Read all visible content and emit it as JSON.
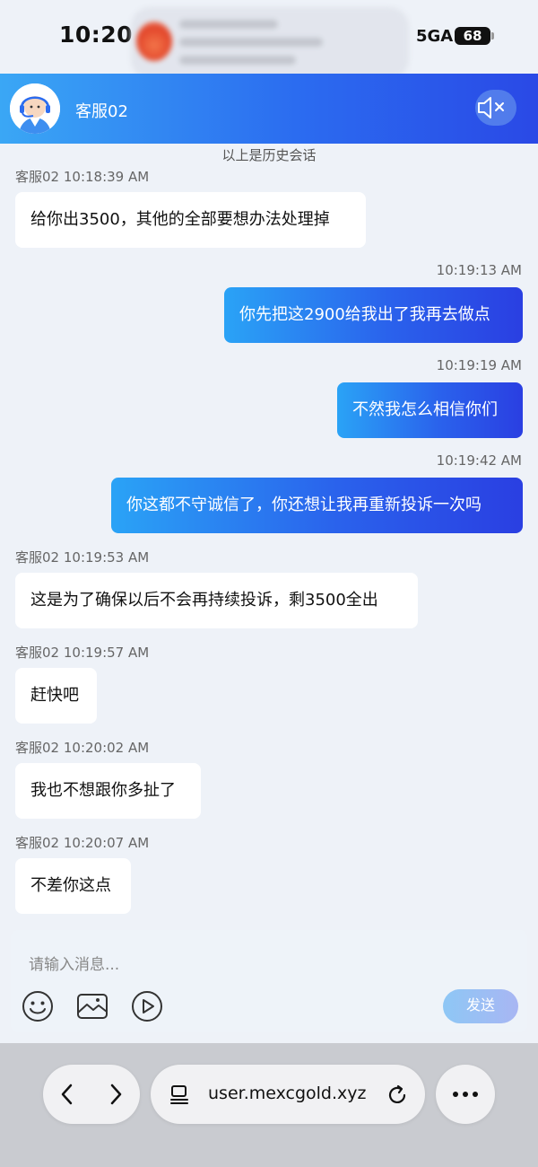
{
  "status": {
    "time": "10:20",
    "network": "5GA",
    "battery": "68"
  },
  "header": {
    "agent_name": "客服02"
  },
  "history_note": "以上是历史会话",
  "messages": [
    {
      "side": "left",
      "meta": "客服02 10:18:39 AM",
      "text": "给你出3500，其他的全部要想办法处理掉"
    },
    {
      "side": "right",
      "meta": "10:19:13 AM",
      "text": "你先把这2900给我出了我再去做点"
    },
    {
      "side": "right",
      "meta": "10:19:19 AM",
      "text": "不然我怎么相信你们"
    },
    {
      "side": "right",
      "meta": "10:19:42 AM",
      "text": "你这都不守诚信了，你还想让我再重新投诉一次吗"
    },
    {
      "side": "left",
      "meta": "客服02 10:19:53 AM",
      "text": "这是为了确保以后不会再持续投诉，剩3500全出"
    },
    {
      "side": "left",
      "meta": "客服02 10:19:57 AM",
      "text": "赶快吧"
    },
    {
      "side": "left",
      "meta": "客服02 10:20:02 AM",
      "text": "我也不想跟你多扯了"
    },
    {
      "side": "left",
      "meta": "客服02 10:20:07 AM",
      "text": "不差你这点"
    }
  ],
  "composer": {
    "placeholder": "请输入消息...",
    "send_label": "发送",
    "tools": [
      "emoji-icon",
      "image-icon",
      "video-icon"
    ]
  },
  "browser": {
    "url": "user.mexcgold.xyz"
  },
  "colors": {
    "header_start": "#3aa7f5",
    "header_end": "#2a49e6",
    "bubble_right_start": "#2aa3f6",
    "bubble_right_end": "#2a3fe2"
  }
}
